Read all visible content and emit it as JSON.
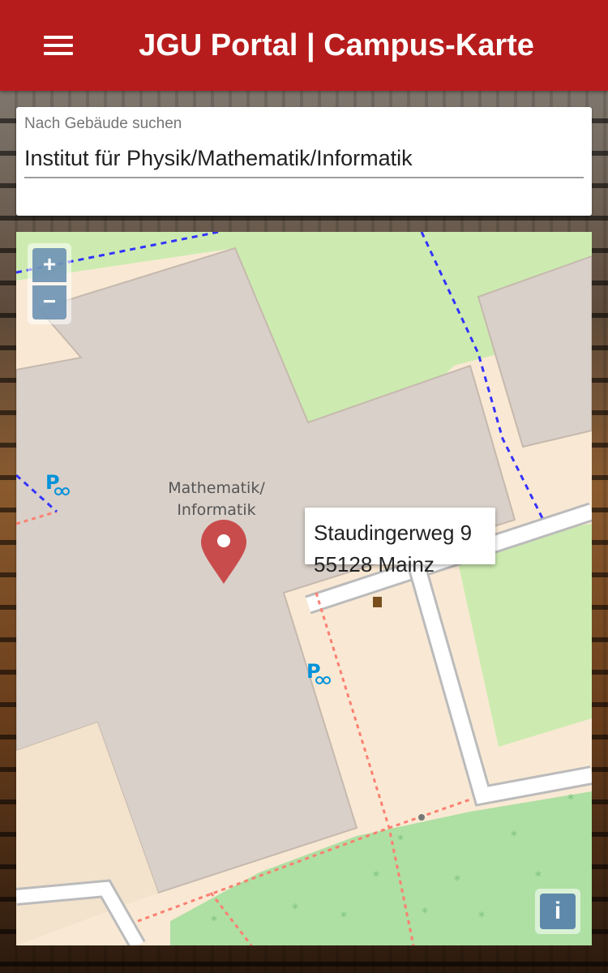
{
  "header": {
    "title": "JGU Portal | Campus-Karte",
    "menu_icon": "hamburger-menu-icon"
  },
  "search": {
    "label": "Nach Gebäude suchen",
    "value": "Institut für Physik/Mathematik/Informatik"
  },
  "map": {
    "building_label_line1": "Mathematik/",
    "building_label_line2": "Informatik",
    "zoom_in_label": "+",
    "zoom_out_label": "−",
    "info_label": "i",
    "popup": {
      "street": "Staudingerweg 9",
      "city": "55128 Mainz"
    },
    "marker_color": "#c94c4c",
    "colors": {
      "building": "#d9d0c9",
      "grass": "#cdebb0",
      "meadow": "#aedfa3",
      "ground": "#f9e9d4",
      "path": "#fa8072",
      "boundary": "#3333ff",
      "parking_icon": "#0092da"
    }
  }
}
